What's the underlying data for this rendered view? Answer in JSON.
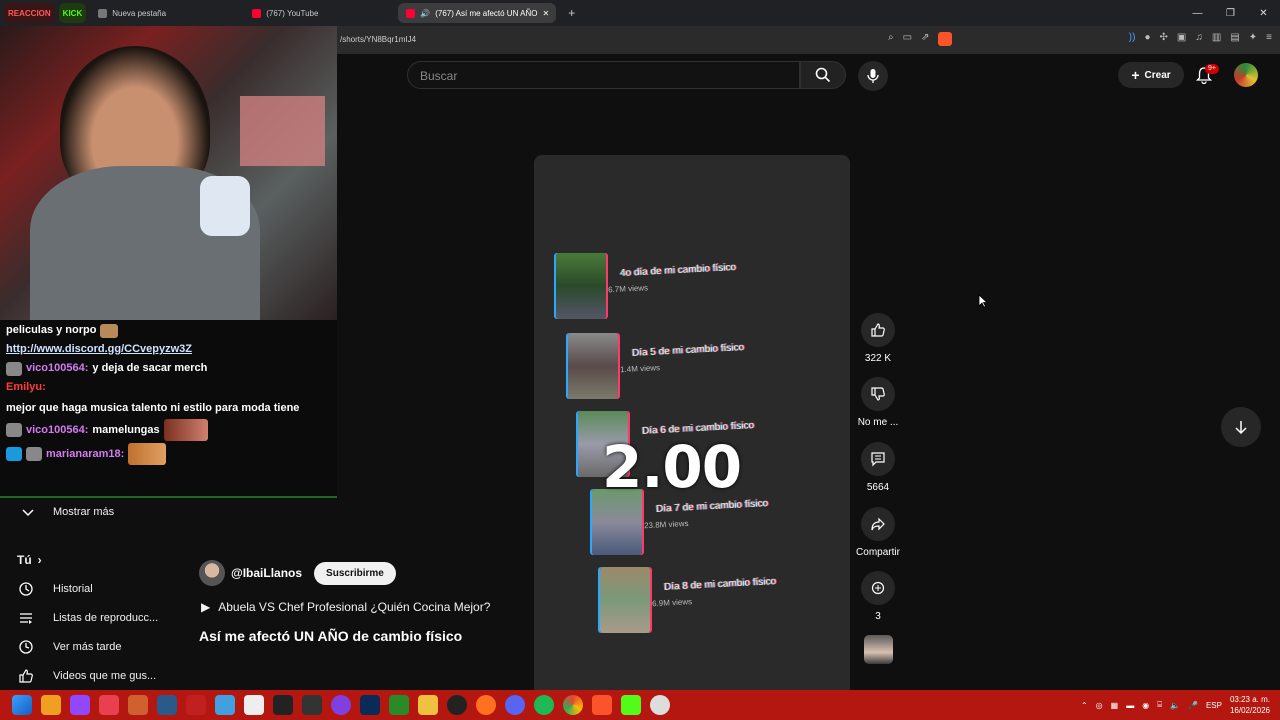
{
  "browser": {
    "tabs": [
      {
        "label": "REACCION",
        "kind": "badge"
      },
      {
        "label": "KICK",
        "kind": "badge"
      },
      {
        "label": "Nueva pestaña",
        "kind": "tab"
      },
      {
        "label": "(767) YouTube",
        "kind": "tab"
      },
      {
        "label": "(767) Así me afectó UN AÑO",
        "kind": "active"
      }
    ],
    "new_tab": "+",
    "url": "/shorts/YN8Bqr1mIJ4"
  },
  "youtube": {
    "search_placeholder": "Buscar",
    "create_label": "Crear",
    "notif_badge": "9+"
  },
  "chat": {
    "lines": [
      {
        "user": "",
        "text": "peliculas y norpo"
      },
      {
        "user": "",
        "text": "http://www.discord.gg/CCvepyzw3Z"
      },
      {
        "user": "vico100564:",
        "text": "y deja de sacar merch"
      },
      {
        "user": "Emilyu:",
        "text": "mejor que haga musica talento ni estilo para moda tiene"
      },
      {
        "user": "vico100564:",
        "text": "mamelungas"
      },
      {
        "user": "marianaram18:",
        "text": ""
      }
    ]
  },
  "sidebar": {
    "show_more": "Mostrar más",
    "you_heading": "Tú",
    "items": [
      "Historial",
      "Listas de reproducc...",
      "Ver más tarde",
      "Videos que me gus..."
    ]
  },
  "short": {
    "clips": [
      {
        "title": "4o día de mi cambio físico",
        "views": "6.7M views"
      },
      {
        "title": "Día 5 de mi cambio físico",
        "views": "1.4M views"
      },
      {
        "title": "Día 6 de mi cambio físico",
        "views": ""
      },
      {
        "title": "Día 7 de mi cambio físico",
        "views": "23.8M views"
      },
      {
        "title": "Día 8 de mi cambio físico",
        "views": "6.9M views"
      }
    ],
    "overlay_number": "2.00",
    "progress": 0.14
  },
  "actions": {
    "likes": "322 K",
    "dislike": "No me ...",
    "comments": "5664",
    "share": "Compartir",
    "remix": "3"
  },
  "video": {
    "channel": "@IbaiLlanos",
    "subscribe": "Suscribirme",
    "related": "Abuela VS Chef Profesional ¿Quién Cocina Mejor?",
    "title": "Así me afectó UN AÑO de cambio físico"
  },
  "taskbar": {
    "lang": "ESP",
    "time": "03:23 a. m.",
    "date": "16/02/2026"
  }
}
